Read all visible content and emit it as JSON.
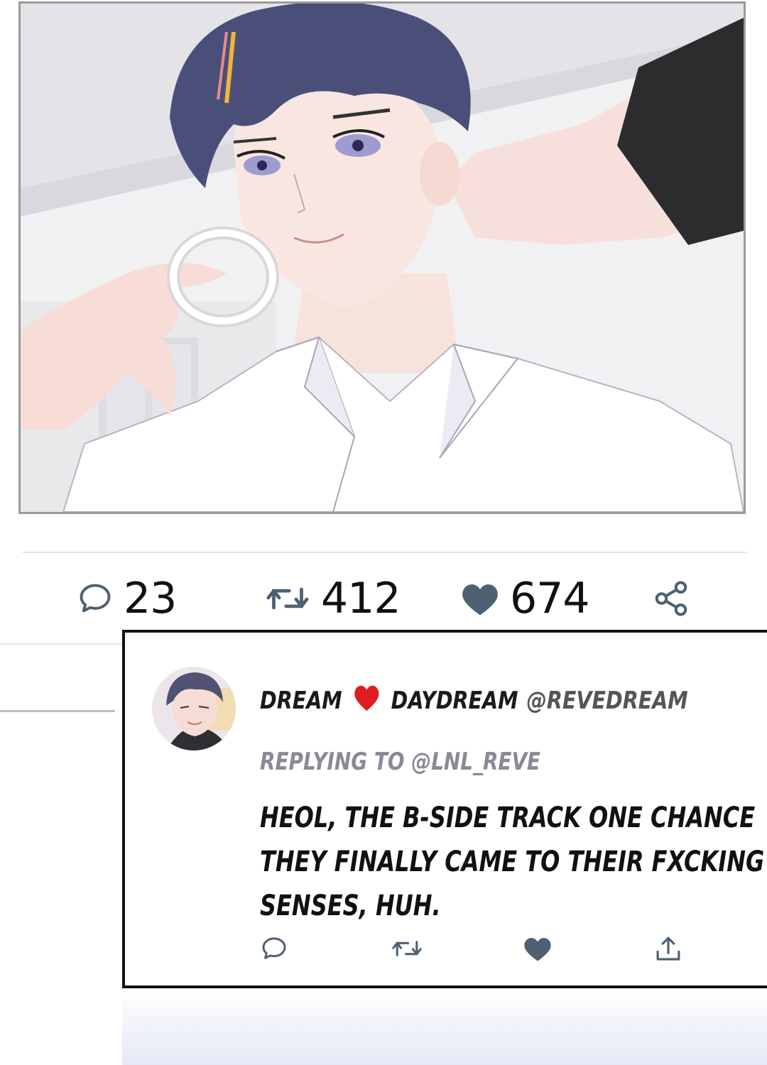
{
  "stats": {
    "comments": "23",
    "retweets": "412",
    "likes": "674"
  },
  "reply": {
    "display_name_left": "DREAM",
    "display_name_right": "DAYDREAM",
    "handle": "@REVEDREAM",
    "replying_to": "REPLYING TO @LNL_REVE",
    "body_lines": [
      "HEOL, THE B-SIDE TRACK ONE CHANCE",
      "THEY FINALLY CAME TO THEIR FXCKING",
      "SENSES, HUH."
    ]
  },
  "colors": {
    "icon": "#4f6073",
    "heart_red": "#e11d24",
    "hair": "#4a4f7a",
    "shirt": "#ffffff",
    "skin": "#f6dcd7"
  },
  "icons": {
    "comment": "speech-bubble-icon",
    "retweet": "retweet-icon",
    "like": "heart-icon",
    "share": "share-icon",
    "upload": "upload-icon"
  }
}
